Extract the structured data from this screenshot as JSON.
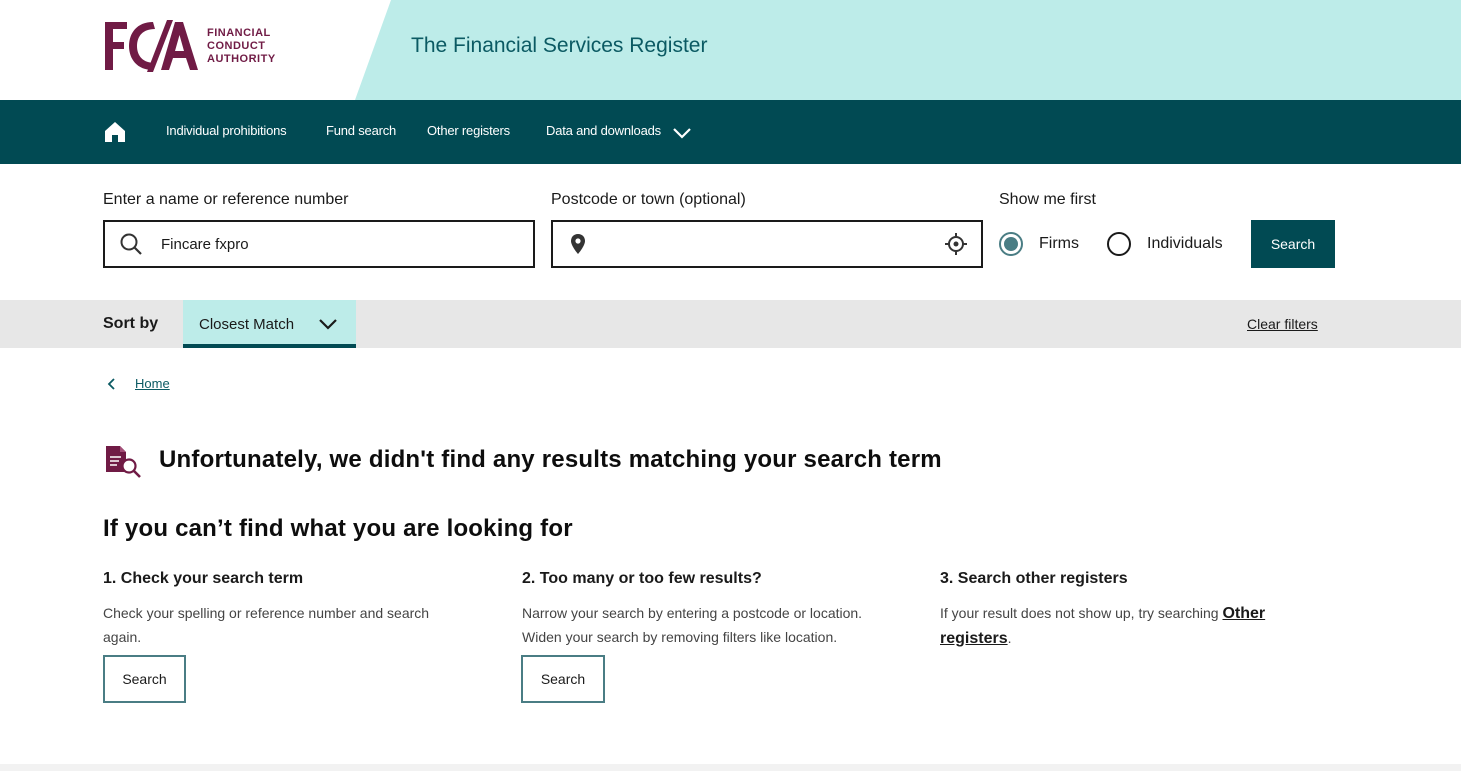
{
  "header": {
    "logo_letters": "FCA",
    "logo_lines": [
      "FINANCIAL",
      "CONDUCT",
      "AUTHORITY"
    ],
    "site_title": "The Financial Services Register",
    "brand_color": "#701b45",
    "band_color": "#bdece9"
  },
  "nav": {
    "home_icon": "home-icon",
    "items": [
      {
        "label": "Individual prohibitions"
      },
      {
        "label": "Fund search"
      },
      {
        "label": "Other registers"
      },
      {
        "label": "Data and downloads"
      }
    ],
    "background": "#014a53"
  },
  "search": {
    "name_label": "Enter a name or reference number",
    "name_value": "Fincare fxpro",
    "location_label": "Postcode or town (optional)",
    "location_value": "",
    "show_first_label": "Show me first",
    "options": [
      {
        "label": "Firms",
        "checked": true
      },
      {
        "label": "Individuals",
        "checked": false
      }
    ],
    "button_label": "Search"
  },
  "sort": {
    "label": "Sort by",
    "selected": "Closest Match",
    "clear_filters": "Clear filters"
  },
  "breadcrumb": {
    "home": "Home"
  },
  "results": {
    "no_results_message": "Unfortunately, we didn't find any results matching your search term"
  },
  "help": {
    "title": "If you can’t find what you are looking for",
    "columns": [
      {
        "title": "1. Check your search term",
        "line1": "Check your spelling or reference number and search",
        "line2": "again.",
        "button": "Search"
      },
      {
        "title": "2. Too many or too few results?",
        "line1": "Narrow your search by entering a postcode or location.",
        "line2": "Widen your search by removing filters like location.",
        "button": "Search"
      },
      {
        "title": "3. Search other registers",
        "line1": "If your result does not show up, try searching ",
        "link_part1": "Other",
        "link_part2": "registers",
        "after_link": "."
      }
    ]
  }
}
